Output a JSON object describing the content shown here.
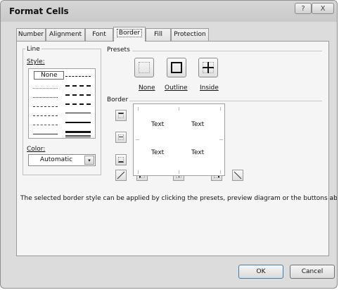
{
  "window": {
    "title": "Format Cells",
    "help_glyph": "?",
    "close_glyph": "X"
  },
  "tabs": [
    {
      "label": "Number"
    },
    {
      "label": "Alignment"
    },
    {
      "label": "Font"
    },
    {
      "label": "Border",
      "active": true
    },
    {
      "label": "Fill"
    },
    {
      "label": "Protection"
    }
  ],
  "line": {
    "group_label": "Line",
    "style_label": "Style:",
    "style_none": "None",
    "color_label": "Color:",
    "color_value": "Automatic",
    "dropdown_glyph": "▾"
  },
  "presets": {
    "label": "Presets",
    "none": "None",
    "outline": "Outline",
    "inside": "Inside"
  },
  "border": {
    "label": "Border",
    "preview_text": [
      "Text",
      "Text",
      "Text",
      "Text"
    ]
  },
  "description": "The selected border style can be applied by clicking the presets, preview diagram or the buttons above.",
  "buttons": {
    "ok": "OK",
    "cancel": "Cancel"
  }
}
